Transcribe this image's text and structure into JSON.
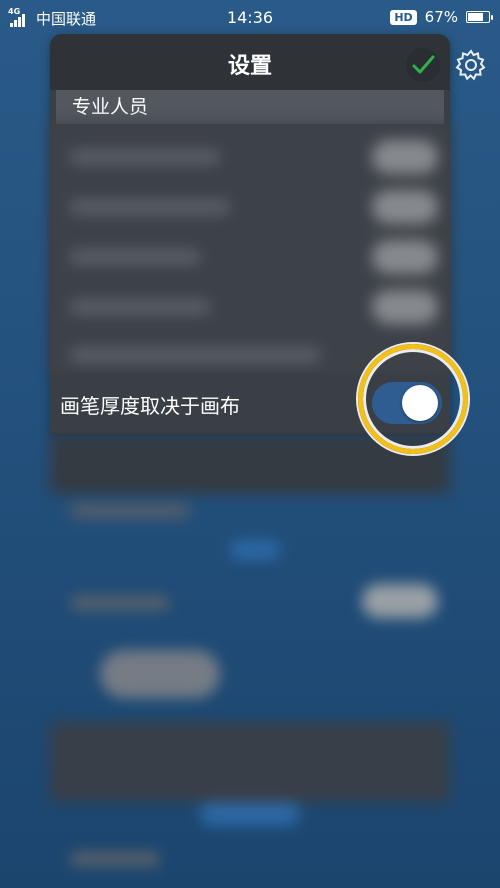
{
  "status_bar": {
    "network": "4G",
    "carrier": "中国联通",
    "time": "14:36",
    "hd": "HD",
    "battery": "67%",
    "battery_level": 0.67
  },
  "panel": {
    "title": "设置",
    "section_label": "专业人员"
  },
  "setting": {
    "label": "画笔厚度取决于画布",
    "toggle_on": true
  },
  "colors": {
    "highlight": "#f2c018",
    "toggle_on": "#2f5c91",
    "check": "#2db34a"
  },
  "icons": [
    "check-icon",
    "gear-icon",
    "signal-icon",
    "battery-icon"
  ]
}
